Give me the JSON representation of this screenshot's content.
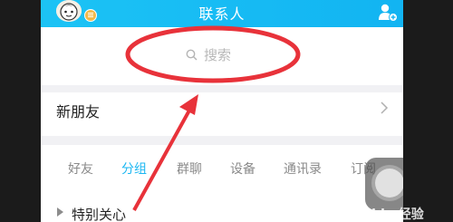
{
  "header": {
    "title": "联系人",
    "avatar_icon": "avatar",
    "add_contact_icon": "add-contact-icon",
    "bg_color": "#12b4f2"
  },
  "search": {
    "placeholder": "搜索"
  },
  "new_friends": {
    "label": "新朋友"
  },
  "tabs": [
    {
      "label": "好友",
      "active": false
    },
    {
      "label": "分组",
      "active": true
    },
    {
      "label": "群聊",
      "active": false
    },
    {
      "label": "设备",
      "active": false
    },
    {
      "label": "通讯录",
      "active": false
    },
    {
      "label": "订阅",
      "active": false
    }
  ],
  "groups": [
    {
      "label": "特别关心"
    }
  ],
  "colors": {
    "accent": "#1bb7f2",
    "annotation": "#e8323a"
  },
  "watermark": {
    "text": "Baidu 经验"
  }
}
